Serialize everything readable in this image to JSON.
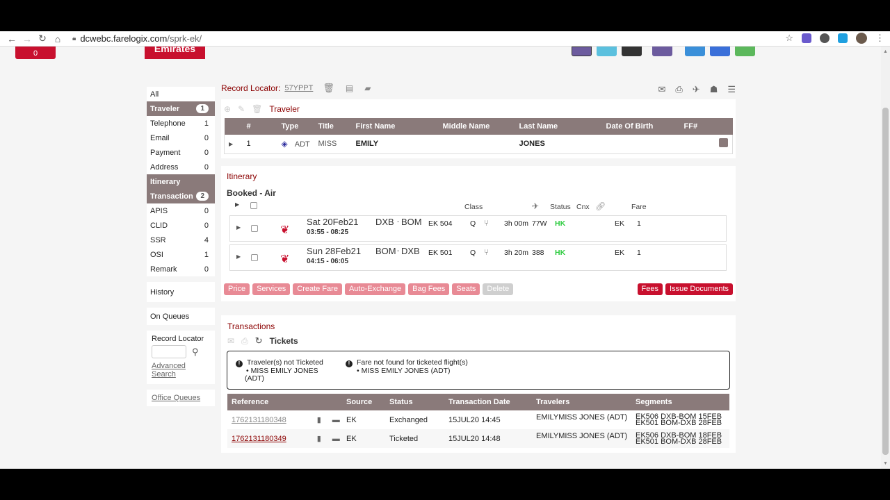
{
  "browser": {
    "url_host": "dcwebc.farelogix.com",
    "url_path": "/sprk-ek/"
  },
  "header": {
    "cart_count": "0",
    "logo_text": "Emirates"
  },
  "sidebar": {
    "items": [
      {
        "label": "All",
        "count": ""
      },
      {
        "label": "Traveler",
        "count": "1"
      },
      {
        "label": "Telephone",
        "count": "1"
      },
      {
        "label": "Email",
        "count": "0"
      },
      {
        "label": "Payment",
        "count": "0"
      },
      {
        "label": "Address",
        "count": "0"
      },
      {
        "label": "Itinerary",
        "count": ""
      },
      {
        "label": "Transaction",
        "count": "2"
      },
      {
        "label": "APIS",
        "count": "0"
      },
      {
        "label": "CLID",
        "count": "0"
      },
      {
        "label": "SSR",
        "count": "4"
      },
      {
        "label": "OSI",
        "count": "1"
      },
      {
        "label": "Remark",
        "count": "0"
      }
    ],
    "history": "History",
    "on_queues": "On Queues",
    "record_locator_label": "Record Locator",
    "advanced_search": "Advanced Search",
    "office_queues": "Office Queues"
  },
  "record": {
    "label": "Record Locator:",
    "value": "57YPPT"
  },
  "traveler": {
    "title": "Traveler",
    "columns": [
      "#",
      "Type",
      "Title",
      "First Name",
      "Middle Name",
      "Last Name",
      "Date Of Birth",
      "FF#"
    ],
    "rows": [
      {
        "num": "1",
        "type": "ADT",
        "title": "MISS",
        "first": "EMILY",
        "middle": "",
        "last": "JONES",
        "dob": ""
      }
    ]
  },
  "itinerary": {
    "title": "Itinerary",
    "subtitle": "Booked - Air",
    "headers": {
      "class": "Class",
      "status": "Status",
      "cnx": "Cnx",
      "fare": "Fare"
    },
    "segments": [
      {
        "date": "Sat 20Feb21",
        "times": "03:55 - 08:25",
        "route_from": "DXB",
        "route_to": "BOM",
        "flight": "EK 504",
        "class": "Q",
        "duration": "3h 00m",
        "equip": "77W",
        "status": "HK",
        "fare_carrier": "EK",
        "fare_num": "1"
      },
      {
        "date": "Sun 28Feb21",
        "times": "04:15 - 06:05",
        "route_from": "BOM",
        "route_to": "DXB",
        "flight": "EK 501",
        "class": "Q",
        "duration": "3h 20m",
        "equip": "388",
        "status": "HK",
        "fare_carrier": "EK",
        "fare_num": "1"
      }
    ],
    "buttons": [
      "Price",
      "Services",
      "Create Fare",
      "Auto-Exchange",
      "Bag Fees",
      "Seats",
      "Delete"
    ],
    "right_buttons": [
      "Fees",
      "Issue Documents"
    ]
  },
  "transactions": {
    "title": "Transactions",
    "tickets_label": "Tickets",
    "alert1_title": "Traveler(s) not Ticketed",
    "alert1_item_a": "• MISS EMILY JONES",
    "alert1_item_b": "(ADT)",
    "alert2_title": "Fare not found for ticketed flight(s)",
    "alert2_item": "• MISS EMILY JONES (ADT)",
    "columns": [
      "Reference",
      "Source",
      "Status",
      "Transaction Date",
      "Travelers",
      "Segments"
    ],
    "rows": [
      {
        "ref": "1762131180348",
        "source": "EK",
        "status": "Exchanged",
        "date": "15JUL20 14:45",
        "travelers": "EMILYMISS JONES (ADT)",
        "seg1": "EK506 DXB-BOM 15FEB",
        "seg2": "EK501 BOM-DXB 28FEB"
      },
      {
        "ref": "1762131180349",
        "source": "EK",
        "status": "Ticketed",
        "date": "15JUL20 14:48",
        "travelers": "EMILYMISS JONES (ADT)",
        "seg1": "EK506 DXB-BOM 18FEB",
        "seg2": "EK501 BOM-DXB 28FEB"
      }
    ]
  },
  "colors": {
    "brand_red": "#c8102e",
    "header_gray": "#8a7a7a",
    "status_green": "#2ecc40"
  }
}
